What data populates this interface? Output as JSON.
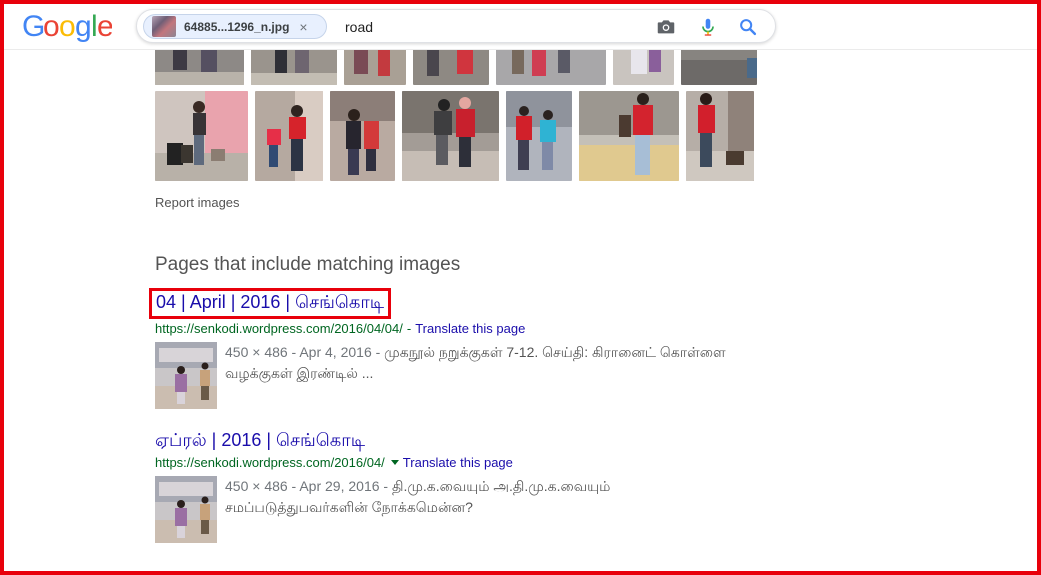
{
  "header": {
    "logo_text": "Google",
    "image_chip_name": "64885...1296_n.jpg",
    "chip_close": "×",
    "query": "road",
    "icons": [
      "camera-icon",
      "microphone-icon",
      "search-icon"
    ]
  },
  "image_grid": {
    "row1_count": 7,
    "row2_count": 8
  },
  "report_images": "Report images",
  "section_title": "Pages that include matching images",
  "results": [
    {
      "title": "04 | April | 2016 | செங்கொடி",
      "url": "https://senkodi.wordpress.com/2016/04/04/",
      "url_separator": "-",
      "translate": "Translate this page",
      "meta": "450 × 486 - Apr 4, 2016 -",
      "snippet": "முகநூல் நறுக்குகள் 7-12. செய்தி: கிரானைட் கொள்ளை வழக்குகள் இரண்டில் ..."
    },
    {
      "title": "ஏப்ரல் | 2016 | செங்கொடி",
      "url": "https://senkodi.wordpress.com/2016/04/",
      "translate": "Translate this page",
      "meta": "450 × 486 - Apr 29, 2016 -",
      "snippet": "தி.மு.க.வையும் அ.தி.மு.க.வையும் சமப்படுத்துபவர்களின் நோக்கமென்ன?"
    }
  ],
  "colors": {
    "highlight_box": "#e8000b",
    "link": "#1a0dab",
    "url": "#006621",
    "snippet": "#545454"
  }
}
